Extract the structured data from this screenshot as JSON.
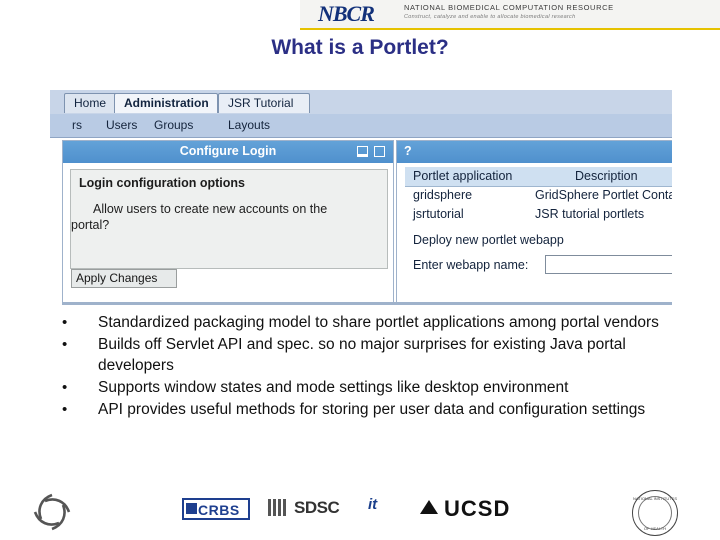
{
  "header": {
    "logo_text": "NBCR",
    "org_title": "NATIONAL BIOMEDICAL COMPUTATION RESOURCE",
    "org_tagline": "Construct, catalyze and enable to allocate biomedical research"
  },
  "slide": {
    "title": "What is a Portlet?"
  },
  "screenshot": {
    "tabs": [
      {
        "label": "Home"
      },
      {
        "label": "Administration"
      },
      {
        "label": "JSR Tutorial"
      }
    ],
    "menu": [
      {
        "label": "rs"
      },
      {
        "label": "Users"
      },
      {
        "label": "Groups"
      },
      {
        "label": "Layouts"
      }
    ],
    "left_portlet": {
      "title": "Configure Login",
      "minimize_icon": "minimize-icon",
      "maximize_icon": "maximize-icon",
      "panel_heading": "Login configuration options",
      "panel_line1": "Allow users to create new accounts on the",
      "panel_line2": "portal?",
      "apply_button": "Apply Changes"
    },
    "right_portlet": {
      "title": "?",
      "table_headers": [
        "Portlet application",
        "Description"
      ],
      "rows": [
        {
          "app": "gridsphere",
          "description": "GridSphere Portlet Container"
        },
        {
          "app": "jsrtutorial",
          "description": "JSR tutorial portlets"
        }
      ],
      "deploy_heading": "Deploy new portlet webapp",
      "webapp_label": "Enter webapp name:",
      "webapp_value": "",
      "webapp_placeholder": ""
    }
  },
  "bullets": [
    "Standardized packaging model to share portlet applications among portal vendors",
    "Builds off Servlet API and spec. so no major surprises for existing Java portal developers",
    "Supports window states and mode settings like desktop environment",
    "API provides useful methods for storing per user data and configuration settings"
  ],
  "footer": {
    "logos": [
      {
        "name": "swirl-logo",
        "label": ""
      },
      {
        "name": "crbs-logo",
        "label": "CRBS"
      },
      {
        "name": "sdsc-logo",
        "label": "SDSC"
      },
      {
        "name": "it-logo",
        "label": "it"
      },
      {
        "name": "ucsd-logo",
        "label": "UCSD"
      },
      {
        "name": "seal-logo",
        "label": ""
      }
    ],
    "seal_top_text": "NATIONAL INSTITUTES",
    "seal_bottom_text": "OF HEALTH"
  },
  "colors": {
    "title_blue": "#2b2f85",
    "nbcr_blue": "#12317a",
    "gold_rule": "#e6c200",
    "portlet_title": "#4f90cd",
    "tabbar": "#c8d5e8"
  }
}
